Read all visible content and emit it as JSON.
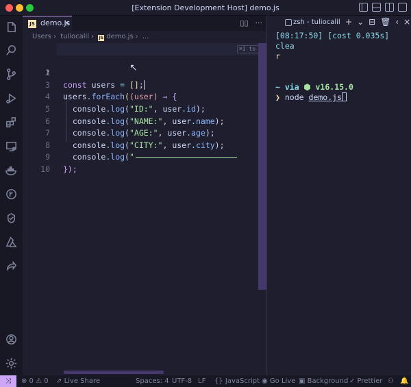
{
  "window": {
    "title": "[Extension Development Host] demo.js"
  },
  "activity_bar": {
    "icons": [
      "explorer-icon",
      "search-icon",
      "source-control-icon",
      "run-debug-icon",
      "extensions-icon",
      "remote-explorer-icon",
      "docker-icon",
      "gitlens-icon",
      "testing-icon",
      "azure-icon",
      "live-share-icon",
      "account-icon",
      "settings-gear-icon"
    ]
  },
  "editor": {
    "tab_label": "demo.js",
    "tab_close": "×",
    "breadcrumb": [
      "Users",
      "tuliocalil",
      "demo.js",
      "..."
    ],
    "inline_hint": "⌘I to chat",
    "lines": [
      {
        "n": "1"
      },
      {
        "n": "2"
      },
      {
        "n": "3"
      },
      {
        "n": "4"
      },
      {
        "n": "5"
      },
      {
        "n": "6"
      },
      {
        "n": "7"
      },
      {
        "n": "8"
      },
      {
        "n": "9"
      },
      {
        "n": "10"
      }
    ],
    "code": {
      "l1_kw": "const",
      "l1_var": "users",
      "l1_op": "=",
      "l1_val": "[]",
      "l1_end": ";",
      "l3_obj": "users",
      "l3_method": "forEach",
      "l3_param": "(user)",
      "l3_arrow": "⇒",
      "l3_brace": "{",
      "log_obj": "console",
      "log_fn": "log",
      "l4_str": "\"ID:\"",
      "l4_prop": "id",
      "l5_str": "\"NAME:\"",
      "l5_prop": "name",
      "l6_str": "\"AGE:\"",
      "l6_prop": "age",
      "l7_str": "\"CITY:\"",
      "l7_prop": "city",
      "l8_str": "\"",
      "l9_close": "});",
      "user": "user"
    }
  },
  "terminal": {
    "tab_label": "zsh - tuliocalil",
    "line1": "[08:17:50] [cost 0.035s] clea",
    "line1b": "r",
    "line2_prefix": "~ via ",
    "line2_node": "⬢ v16.15.0",
    "prompt": "❯",
    "cmd": "node",
    "arg": "demo.js"
  },
  "status_bar": {
    "remote": "⤨",
    "problems": "⊗ 0 ⚠ 0",
    "live_share": "Live Share",
    "spaces": "Spaces: 4",
    "encoding": "UTF-8",
    "eol": "LF",
    "language": "{} JavaScript",
    "go_live": "Go Live",
    "background": "Background",
    "prettier": "✓ Prettier"
  }
}
